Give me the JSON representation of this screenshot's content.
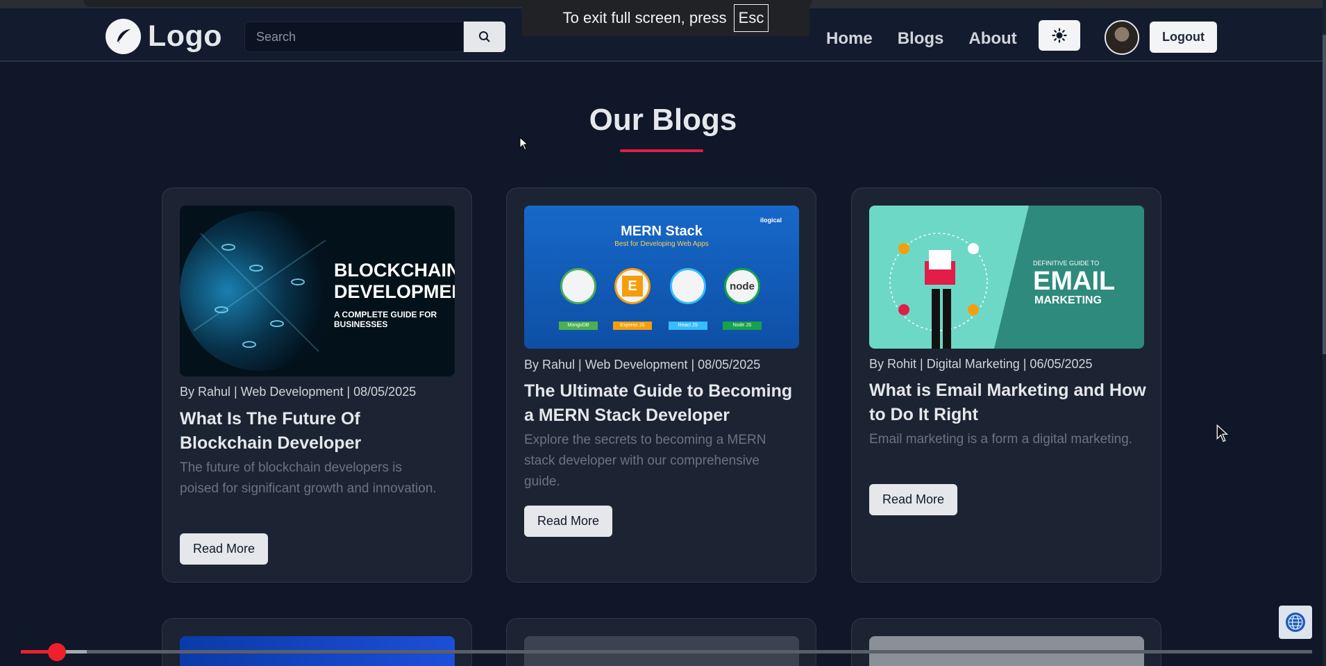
{
  "navbar": {
    "logo_text": "Logo",
    "search_placeholder": "Search",
    "links": [
      "Home",
      "Blogs",
      "About"
    ],
    "logout_label": "Logout"
  },
  "fullscreen_notice": {
    "text": "To exit full screen, press",
    "key": "Esc"
  },
  "section": {
    "title": "Our Blogs",
    "accent_color": "#e11d48"
  },
  "cards": [
    {
      "image_heading": "BLOCKCHAIN DEVELOPMENT",
      "image_sub": "A COMPLETE GUIDE FOR BUSINESSES",
      "meta": "By Rahul | Web Development | 08/05/2025",
      "title": "What Is The Future Of Blockchain Developer",
      "excerpt": "The future of blockchain developers is poised for significant growth and innovation.",
      "button": "Read More"
    },
    {
      "image_heading": "MERN Stack",
      "image_sub": "Best for Developing Web Apps",
      "image_brand": "ilogical",
      "image_icons": [
        {
          "letter": "",
          "label": "MongoDB",
          "color": "#4caf50"
        },
        {
          "letter": "E",
          "label": "Express JS",
          "color": "#f59e0b"
        },
        {
          "letter": "",
          "label": "React JS",
          "color": "#38bdf8"
        },
        {
          "letter": "node",
          "label": "Node JS",
          "color": "#16a34a"
        }
      ],
      "meta": "By Rahul | Web Development | 08/05/2025",
      "title": "The Ultimate Guide to Becoming a MERN Stack Developer",
      "excerpt": "Explore the secrets to becoming a MERN stack developer with our comprehensive guide.",
      "button": "Read More"
    },
    {
      "image_kicker": "DEFINITIVE GUIDE TO",
      "image_heading": "EMAIL",
      "image_sub": "MARKETING",
      "meta": "By Rohit | Digital Marketing | 06/05/2025",
      "title": "What is Email Marketing and How to Do It Right",
      "excerpt": "Email marketing is a form a digital marketing.",
      "button": "Read More"
    }
  ],
  "video": {
    "progress_fraction": 0.028,
    "buffered_fraction": 0.051
  },
  "icons": {
    "logo": "feather-icon",
    "search": "search-icon",
    "theme": "sun-icon",
    "globe": "globe-icon"
  }
}
